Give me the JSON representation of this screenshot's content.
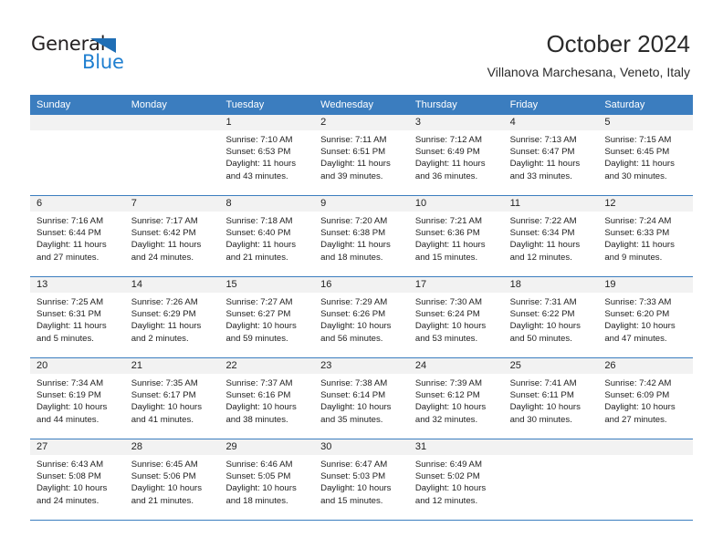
{
  "logo": {
    "word_top": "General",
    "word_bottom": "Blue",
    "triangle_color": "#1f6eb5",
    "blue_color": "#1f7fd0"
  },
  "header": {
    "title": "October 2024",
    "subtitle": "Villanova Marchesana, Veneto, Italy"
  },
  "theme": {
    "header_blue": "#3b7dbf",
    "day_number_bg": "#f2f2f2",
    "text": "#222222"
  },
  "weekdays": [
    "Sunday",
    "Monday",
    "Tuesday",
    "Wednesday",
    "Thursday",
    "Friday",
    "Saturday"
  ],
  "weeks": [
    [
      {
        "day": "",
        "sunrise": "",
        "sunset": "",
        "daylight_line1": "",
        "daylight_line2": ""
      },
      {
        "day": "",
        "sunrise": "",
        "sunset": "",
        "daylight_line1": "",
        "daylight_line2": ""
      },
      {
        "day": "1",
        "sunrise": "Sunrise: 7:10 AM",
        "sunset": "Sunset: 6:53 PM",
        "daylight_line1": "Daylight: 11 hours",
        "daylight_line2": "and 43 minutes."
      },
      {
        "day": "2",
        "sunrise": "Sunrise: 7:11 AM",
        "sunset": "Sunset: 6:51 PM",
        "daylight_line1": "Daylight: 11 hours",
        "daylight_line2": "and 39 minutes."
      },
      {
        "day": "3",
        "sunrise": "Sunrise: 7:12 AM",
        "sunset": "Sunset: 6:49 PM",
        "daylight_line1": "Daylight: 11 hours",
        "daylight_line2": "and 36 minutes."
      },
      {
        "day": "4",
        "sunrise": "Sunrise: 7:13 AM",
        "sunset": "Sunset: 6:47 PM",
        "daylight_line1": "Daylight: 11 hours",
        "daylight_line2": "and 33 minutes."
      },
      {
        "day": "5",
        "sunrise": "Sunrise: 7:15 AM",
        "sunset": "Sunset: 6:45 PM",
        "daylight_line1": "Daylight: 11 hours",
        "daylight_line2": "and 30 minutes."
      }
    ],
    [
      {
        "day": "6",
        "sunrise": "Sunrise: 7:16 AM",
        "sunset": "Sunset: 6:44 PM",
        "daylight_line1": "Daylight: 11 hours",
        "daylight_line2": "and 27 minutes."
      },
      {
        "day": "7",
        "sunrise": "Sunrise: 7:17 AM",
        "sunset": "Sunset: 6:42 PM",
        "daylight_line1": "Daylight: 11 hours",
        "daylight_line2": "and 24 minutes."
      },
      {
        "day": "8",
        "sunrise": "Sunrise: 7:18 AM",
        "sunset": "Sunset: 6:40 PM",
        "daylight_line1": "Daylight: 11 hours",
        "daylight_line2": "and 21 minutes."
      },
      {
        "day": "9",
        "sunrise": "Sunrise: 7:20 AM",
        "sunset": "Sunset: 6:38 PM",
        "daylight_line1": "Daylight: 11 hours",
        "daylight_line2": "and 18 minutes."
      },
      {
        "day": "10",
        "sunrise": "Sunrise: 7:21 AM",
        "sunset": "Sunset: 6:36 PM",
        "daylight_line1": "Daylight: 11 hours",
        "daylight_line2": "and 15 minutes."
      },
      {
        "day": "11",
        "sunrise": "Sunrise: 7:22 AM",
        "sunset": "Sunset: 6:34 PM",
        "daylight_line1": "Daylight: 11 hours",
        "daylight_line2": "and 12 minutes."
      },
      {
        "day": "12",
        "sunrise": "Sunrise: 7:24 AM",
        "sunset": "Sunset: 6:33 PM",
        "daylight_line1": "Daylight: 11 hours",
        "daylight_line2": "and 9 minutes."
      }
    ],
    [
      {
        "day": "13",
        "sunrise": "Sunrise: 7:25 AM",
        "sunset": "Sunset: 6:31 PM",
        "daylight_line1": "Daylight: 11 hours",
        "daylight_line2": "and 5 minutes."
      },
      {
        "day": "14",
        "sunrise": "Sunrise: 7:26 AM",
        "sunset": "Sunset: 6:29 PM",
        "daylight_line1": "Daylight: 11 hours",
        "daylight_line2": "and 2 minutes."
      },
      {
        "day": "15",
        "sunrise": "Sunrise: 7:27 AM",
        "sunset": "Sunset: 6:27 PM",
        "daylight_line1": "Daylight: 10 hours",
        "daylight_line2": "and 59 minutes."
      },
      {
        "day": "16",
        "sunrise": "Sunrise: 7:29 AM",
        "sunset": "Sunset: 6:26 PM",
        "daylight_line1": "Daylight: 10 hours",
        "daylight_line2": "and 56 minutes."
      },
      {
        "day": "17",
        "sunrise": "Sunrise: 7:30 AM",
        "sunset": "Sunset: 6:24 PM",
        "daylight_line1": "Daylight: 10 hours",
        "daylight_line2": "and 53 minutes."
      },
      {
        "day": "18",
        "sunrise": "Sunrise: 7:31 AM",
        "sunset": "Sunset: 6:22 PM",
        "daylight_line1": "Daylight: 10 hours",
        "daylight_line2": "and 50 minutes."
      },
      {
        "day": "19",
        "sunrise": "Sunrise: 7:33 AM",
        "sunset": "Sunset: 6:20 PM",
        "daylight_line1": "Daylight: 10 hours",
        "daylight_line2": "and 47 minutes."
      }
    ],
    [
      {
        "day": "20",
        "sunrise": "Sunrise: 7:34 AM",
        "sunset": "Sunset: 6:19 PM",
        "daylight_line1": "Daylight: 10 hours",
        "daylight_line2": "and 44 minutes."
      },
      {
        "day": "21",
        "sunrise": "Sunrise: 7:35 AM",
        "sunset": "Sunset: 6:17 PM",
        "daylight_line1": "Daylight: 10 hours",
        "daylight_line2": "and 41 minutes."
      },
      {
        "day": "22",
        "sunrise": "Sunrise: 7:37 AM",
        "sunset": "Sunset: 6:16 PM",
        "daylight_line1": "Daylight: 10 hours",
        "daylight_line2": "and 38 minutes."
      },
      {
        "day": "23",
        "sunrise": "Sunrise: 7:38 AM",
        "sunset": "Sunset: 6:14 PM",
        "daylight_line1": "Daylight: 10 hours",
        "daylight_line2": "and 35 minutes."
      },
      {
        "day": "24",
        "sunrise": "Sunrise: 7:39 AM",
        "sunset": "Sunset: 6:12 PM",
        "daylight_line1": "Daylight: 10 hours",
        "daylight_line2": "and 32 minutes."
      },
      {
        "day": "25",
        "sunrise": "Sunrise: 7:41 AM",
        "sunset": "Sunset: 6:11 PM",
        "daylight_line1": "Daylight: 10 hours",
        "daylight_line2": "and 30 minutes."
      },
      {
        "day": "26",
        "sunrise": "Sunrise: 7:42 AM",
        "sunset": "Sunset: 6:09 PM",
        "daylight_line1": "Daylight: 10 hours",
        "daylight_line2": "and 27 minutes."
      }
    ],
    [
      {
        "day": "27",
        "sunrise": "Sunrise: 6:43 AM",
        "sunset": "Sunset: 5:08 PM",
        "daylight_line1": "Daylight: 10 hours",
        "daylight_line2": "and 24 minutes."
      },
      {
        "day": "28",
        "sunrise": "Sunrise: 6:45 AM",
        "sunset": "Sunset: 5:06 PM",
        "daylight_line1": "Daylight: 10 hours",
        "daylight_line2": "and 21 minutes."
      },
      {
        "day": "29",
        "sunrise": "Sunrise: 6:46 AM",
        "sunset": "Sunset: 5:05 PM",
        "daylight_line1": "Daylight: 10 hours",
        "daylight_line2": "and 18 minutes."
      },
      {
        "day": "30",
        "sunrise": "Sunrise: 6:47 AM",
        "sunset": "Sunset: 5:03 PM",
        "daylight_line1": "Daylight: 10 hours",
        "daylight_line2": "and 15 minutes."
      },
      {
        "day": "31",
        "sunrise": "Sunrise: 6:49 AM",
        "sunset": "Sunset: 5:02 PM",
        "daylight_line1": "Daylight: 10 hours",
        "daylight_line2": "and 12 minutes."
      },
      {
        "day": "",
        "sunrise": "",
        "sunset": "",
        "daylight_line1": "",
        "daylight_line2": ""
      },
      {
        "day": "",
        "sunrise": "",
        "sunset": "",
        "daylight_line1": "",
        "daylight_line2": ""
      }
    ]
  ]
}
